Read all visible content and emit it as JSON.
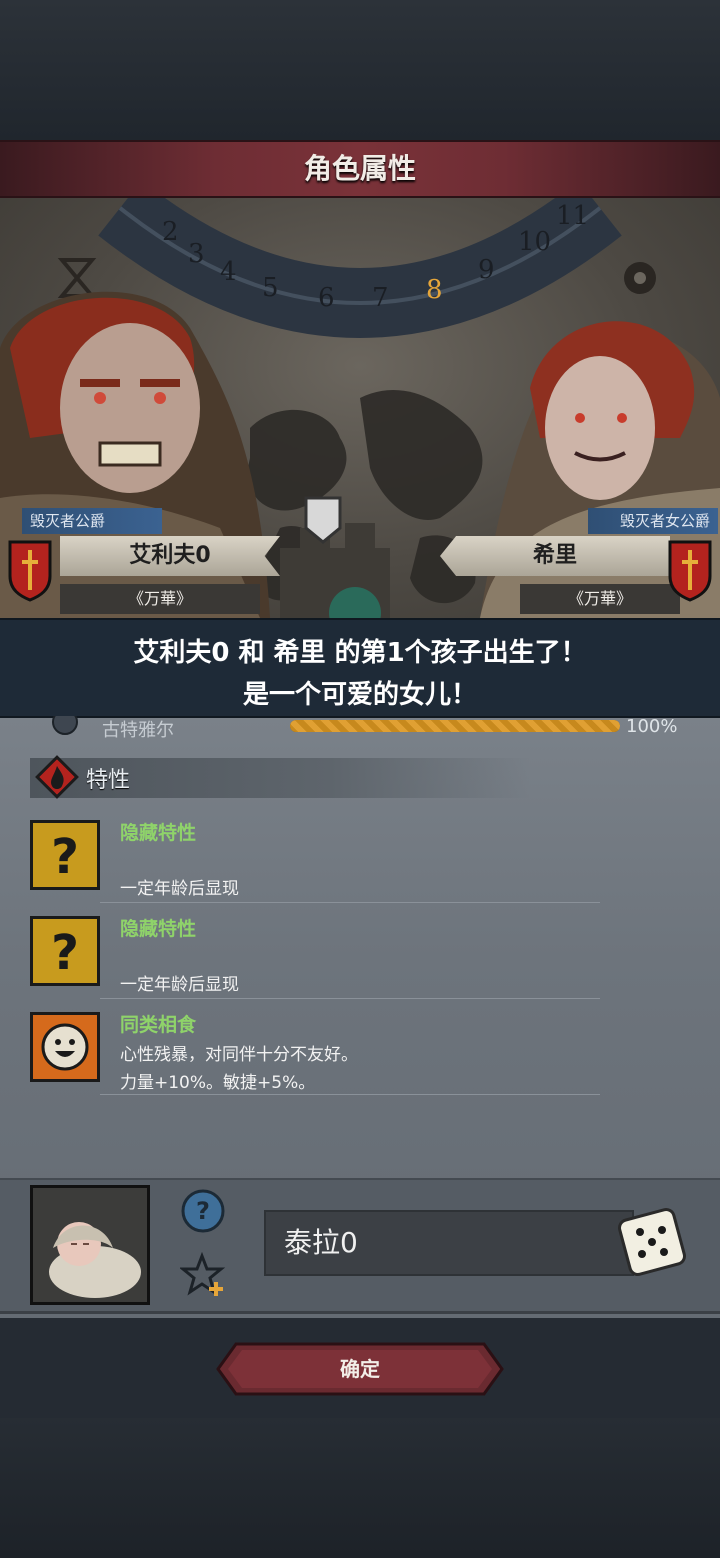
{
  "header": {
    "title": "角色属性"
  },
  "dial": {
    "numbers": [
      "2",
      "3",
      "4",
      "5",
      "6",
      "7",
      "8",
      "9",
      "10",
      "11"
    ],
    "highlight": "8"
  },
  "father": {
    "title": "毁灭者公爵",
    "name": "艾利夫0",
    "house": "《万華》"
  },
  "mother": {
    "title": "毁灭者女公爵",
    "name": "希里",
    "house": "《万華》"
  },
  "message": {
    "line1": "艾利夫0 和 希里 的第1个孩子出生了！",
    "line2": "是一个可爱的女儿！"
  },
  "progress": {
    "label": "古特雅尔",
    "value_text": "100%",
    "value": 1.0
  },
  "traits_section": {
    "title": "特性"
  },
  "traits": [
    {
      "name": "隐藏特性",
      "desc1": "一定年龄后显现",
      "desc2": "",
      "icon": "question-mark-icon"
    },
    {
      "name": "隐藏特性",
      "desc1": "一定年龄后显现",
      "desc2": "",
      "icon": "question-mark-icon"
    },
    {
      "name": "同类相食",
      "desc1": "心性残暴，对同伴十分不友好。",
      "desc2": "力量+10%。敏捷+5%。",
      "icon": "grin-face-icon"
    }
  ],
  "child": {
    "name": "泰拉0"
  },
  "actions": {
    "confirm_label": "确定"
  },
  "colors": {
    "trait_name": "#8fd36a",
    "banner_red": "#7a3239",
    "title_blue": "#3b6291"
  }
}
